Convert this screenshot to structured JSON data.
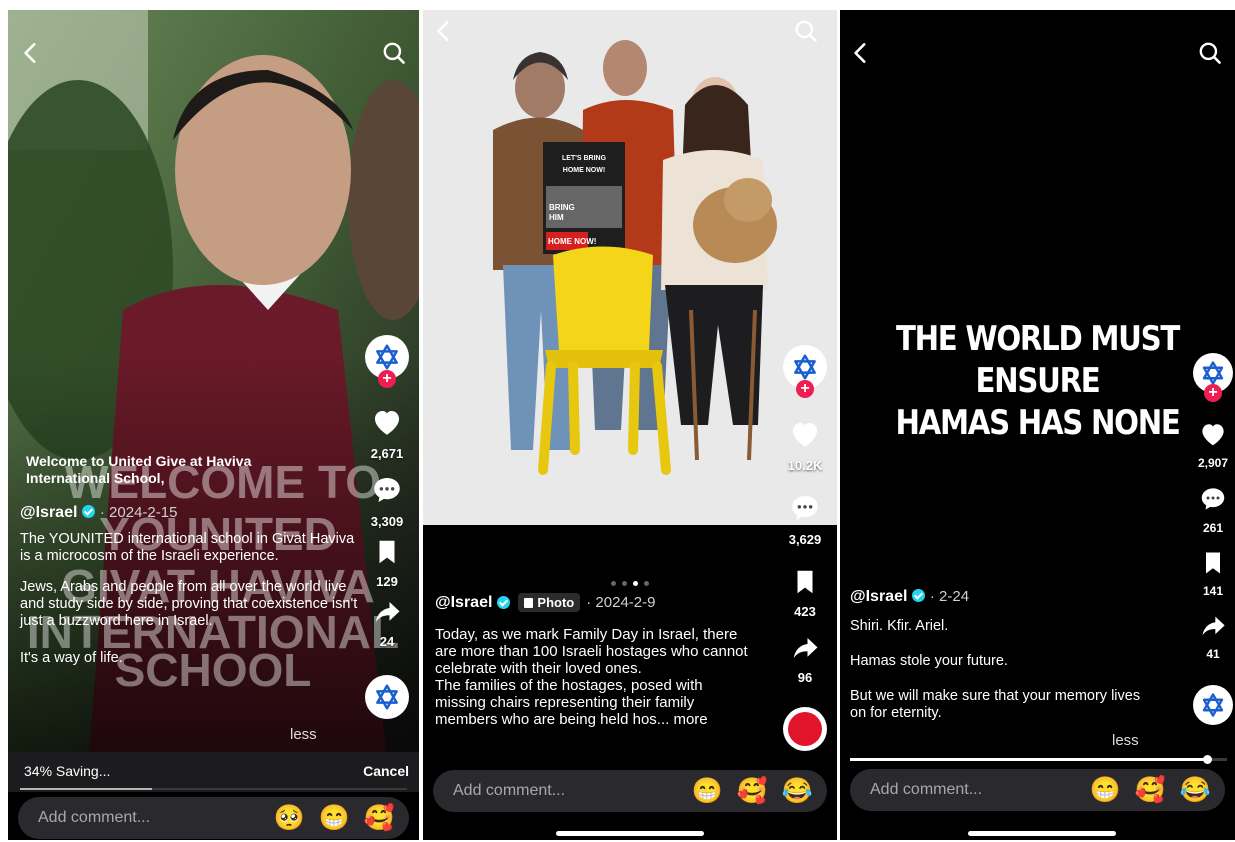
{
  "panel1": {
    "overlay_caption": "Welcome to United Give at Haviva International School,",
    "big_overlay": [
      "WELCOME TO",
      "YOUNITED",
      "GIVAT HAVIVA",
      "INTERNATIONAL",
      "SCHOOL"
    ],
    "handle": "@Israel",
    "date": "· 2024-2-15",
    "desc_1": "The YOUNITED international school in Givat Haviva is a microcosm of the Israeli experience.",
    "desc_2": "Jews, Arabs and people from all over the world live and study side by side, proving that coexistence isn't just a buzzword here in Israel.",
    "desc_3": "It's a way of life.",
    "less": "less",
    "likes": "2,671",
    "comments": "3,309",
    "saves": "129",
    "shares": "24",
    "saving_status": "34% Saving...",
    "saving_progress": 0.34,
    "cancel": "Cancel",
    "comment_placeholder": "Add comment...",
    "emojis": [
      "🥺",
      "😁",
      "🥰"
    ]
  },
  "panel2": {
    "poster_text": [
      "LET'S BRING",
      "HOME NOW!",
      "BRING",
      "HIM",
      "HOME NOW!"
    ],
    "carousel_total": 4,
    "carousel_active": 3,
    "handle": "@Israel",
    "photo_tag": "Photo",
    "date": "· 2024-2-9",
    "desc_1": "Today, as we mark Family Day in Israel, there are more than 100 Israeli hostages who cannot celebrate with their loved ones.",
    "desc_2": "The families of the hostages, posed with missing chairs representing their family members who are being held hos...",
    "more": "more",
    "likes": "10.2K",
    "comments": "3,629",
    "saves": "423",
    "shares": "96",
    "comment_placeholder": "Add comment...",
    "emojis": [
      "😁",
      "🥰",
      "😂"
    ]
  },
  "panel3": {
    "headline_1": "THE WORLD MUST ENSURE",
    "headline_2": "HAMAS HAS NONE",
    "handle": "@Israel",
    "date": "· 2-24",
    "desc_1": "Shiri. Kfir. Ariel.",
    "desc_2": "Hamas stole your future.",
    "desc_3": "But we will make sure that your memory lives on for eternity.",
    "less": "less",
    "likes": "2,907",
    "comments": "261",
    "saves": "141",
    "shares": "41",
    "progress": 0.95,
    "comment_placeholder": "Add comment...",
    "emojis": [
      "😁",
      "🥰",
      "😂"
    ]
  },
  "colors": {
    "accent_red": "#ee1d52",
    "verified": "#20d5ec",
    "star_blue": "#1a5fd0"
  }
}
